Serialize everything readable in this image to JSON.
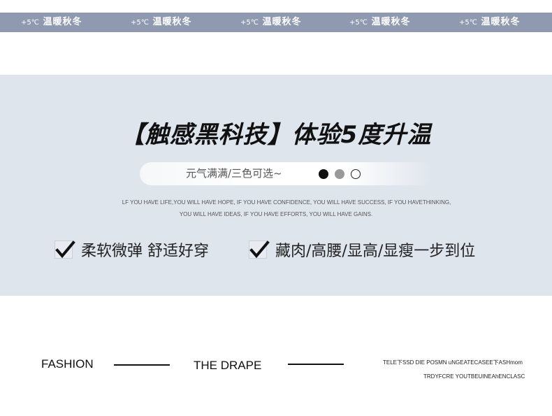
{
  "banner": {
    "items": [
      {
        "temp": "+5℃",
        "text": "温暖秋冬"
      },
      {
        "temp": "+5℃",
        "text": "温暖秋冬"
      },
      {
        "temp": "+5℃",
        "text": "温暖秋冬"
      },
      {
        "temp": "+5℃",
        "text": "温暖秋冬"
      },
      {
        "temp": "+5℃",
        "text": "温暖秋冬"
      }
    ]
  },
  "panel": {
    "headline": "【触感黑科技】体验5度升温",
    "pill_text": "元气满满/三色可选~",
    "color_options": [
      "#111111",
      "#999999",
      "#ffffff"
    ],
    "english_line_1": "LF YOU HAVE LIFE,YOU WILL HAVE HOPE, IF YOU HAVE CONFIDENCE, YOU WILL HAVE SUCCESS, IF YOU HAVETHINKING,",
    "english_line_2": "YOU WILL HAVE IDEAS, IF YOU HAVE EFFORTS, YOU WILL HAVE GAINS.",
    "features": [
      {
        "text": "柔软微弹 舒适好穿"
      },
      {
        "text": "藏肉/高腰/显高/显瘦一步到位"
      }
    ]
  },
  "bottom": {
    "fashion": "FASHION",
    "drape": "THE DRAPE",
    "small_line_1": "TELE下SSD DIE POSMN uNGEATECASEE下ASHmom",
    "small_line_2": "TRDYFCRE YOUTBEUINEAhENCLASC"
  }
}
